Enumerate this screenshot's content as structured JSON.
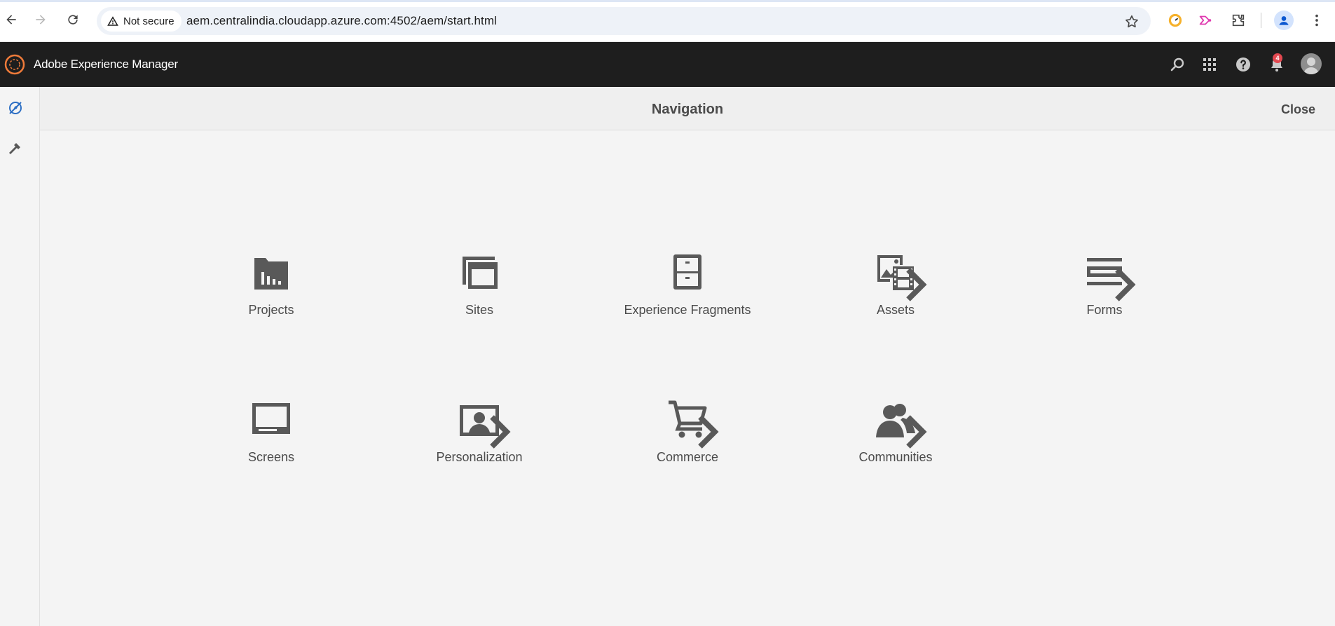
{
  "browser": {
    "security_label": "Not secure",
    "url": "aem.centralindia.cloudapp.azure.com:4502/aem/start.html"
  },
  "shell": {
    "title": "Adobe Experience Manager",
    "notification_count": "4"
  },
  "panel": {
    "title": "Navigation",
    "close_label": "Close"
  },
  "tiles": [
    {
      "label": "Projects",
      "icon": "projects-icon",
      "has_children": false
    },
    {
      "label": "Sites",
      "icon": "sites-icon",
      "has_children": false
    },
    {
      "label": "Experience Fragments",
      "icon": "experience-fragments-icon",
      "has_children": false
    },
    {
      "label": "Assets",
      "icon": "assets-icon",
      "has_children": true
    },
    {
      "label": "Forms",
      "icon": "forms-icon",
      "has_children": true
    },
    {
      "label": "Screens",
      "icon": "screens-icon",
      "has_children": false
    },
    {
      "label": "Personalization",
      "icon": "personalization-icon",
      "has_children": true
    },
    {
      "label": "Commerce",
      "icon": "commerce-icon",
      "has_children": true
    },
    {
      "label": "Communities",
      "icon": "communities-icon",
      "has_children": true
    }
  ],
  "colors": {
    "shell_bg": "#1e1e1e",
    "panel_bg": "#f4f4f4",
    "icon_gray": "#595959",
    "rail_accent": "#2d6fc4"
  }
}
